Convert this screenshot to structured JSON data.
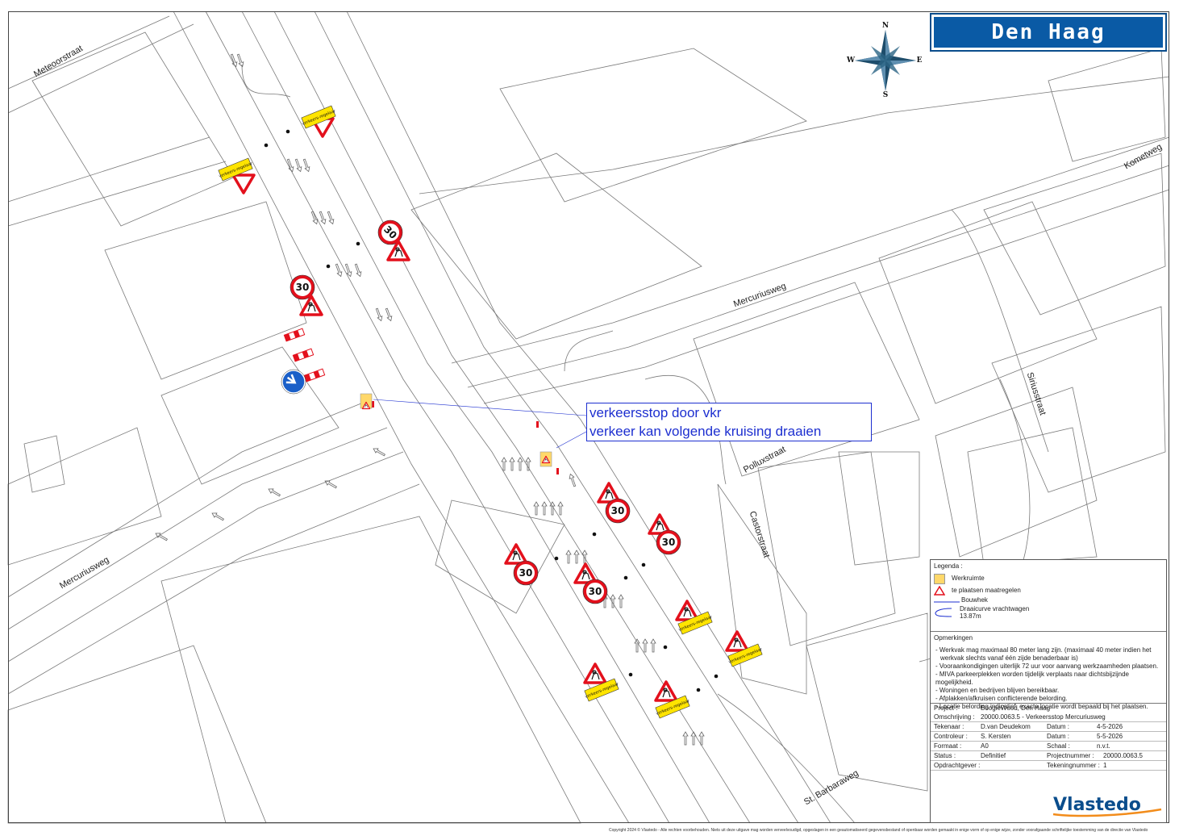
{
  "title": "Den Haag",
  "compass": {
    "n": "N",
    "e": "E",
    "s": "S",
    "w": "W"
  },
  "callout": {
    "line1": "verkeersstop door vkr",
    "line2": "verkeer kan volgende kruising draaien"
  },
  "streets": {
    "meteoorstraat": "Meteoorstraat",
    "mercuriusweg_ne": "Mercuriusweg",
    "mercuriusweg_sw": "Mercuriusweg",
    "kometweg": "Kometweg",
    "siriusstraat": "Siriusstraat",
    "polluxstraat": "Polluxstraat",
    "castorstraat": "Castorstraat",
    "st_barbaraweg": "St. Barbaraweg"
  },
  "signs": {
    "speed": "30",
    "regelaar": "verkeers-regelaar"
  },
  "legend": {
    "heading": "Legenda :",
    "items": [
      {
        "label": "Werkruimte"
      },
      {
        "label": "te plaatsen maatregelen"
      },
      {
        "label": "Bouwhek"
      },
      {
        "label": "Draaicurve vrachtwagen"
      },
      {
        "label": "13.87m"
      }
    ]
  },
  "remarks": {
    "heading": "Opmerkingen",
    "items": [
      "- Werkvak mag maximaal 80 meter lang zijn. (maximaal 40 meter indien het",
      "  werkvak slechts vanaf één zijde benaderbaar is)",
      "- Vooraankondigingen uiterlijk 72 uur voor aanvang werkzaamheden plaatsen.",
      "- MIVA parkeerplekken worden tijdelijk verplaats naar dichtsbijzijnde mogelijkheid.",
      "- Woningen en bedrijven blijven bereikbaar.",
      "- Afplakken/afkruisen conflicterende belording.",
      "- Locatie belording indicatief, exacte locatie wordt bepaald bij het plaatsen."
    ]
  },
  "project": {
    "project_label": "Project :",
    "project_value": "BoogieWood, Den Haag",
    "omschrijving_label": "Omschrijving :",
    "omschrijving_value": "20000.0063.5 - Verkeersstop Mercuriusweg",
    "tekenaar_label": "Tekenaar :",
    "tekenaar_value": "D.van Deudekom",
    "datum1_label": "Datum :",
    "datum1_value": "4-5-2026",
    "controleur_label": "Controleur :",
    "controleur_value": "S. Kersten",
    "datum2_label": "Datum :",
    "datum2_value": "5-5-2026",
    "formaat_label": "Formaat :",
    "formaat_value": "A0",
    "schaal_label": "Schaal :",
    "schaal_value": "n.v.t.",
    "status_label": "Status :",
    "status_value": "Definitief",
    "projectnummer_label": "Projectnummer :",
    "projectnummer_value": "20000.0063.5",
    "opdrachtgever_label": "Opdrachtgever :",
    "opdrachtgever_value": "",
    "tekeningnummer_label": "Tekeningnummer :",
    "tekeningnummer_value": "1"
  },
  "logo": "Vlastedo",
  "copyright": "Copyright 2024 © Vlastedo - Alle rechten voorbehouden. Niets uit deze uitgave mag worden verveelvoudigd, opgeslagen in een geautomatiseerd gegevensbestand of openbaar worden gemaakt in enige vorm of op enige wijze, zonder voorafgaande schriftelijke toestemming van de directie van Vlastedo",
  "colors": {
    "brand_blue": "#0a5aa5",
    "callout_blue": "#1d2fd0",
    "sign_red": "#e3101c",
    "sign_yellow": "#ffe400",
    "logo_orange": "#f28c1b"
  }
}
